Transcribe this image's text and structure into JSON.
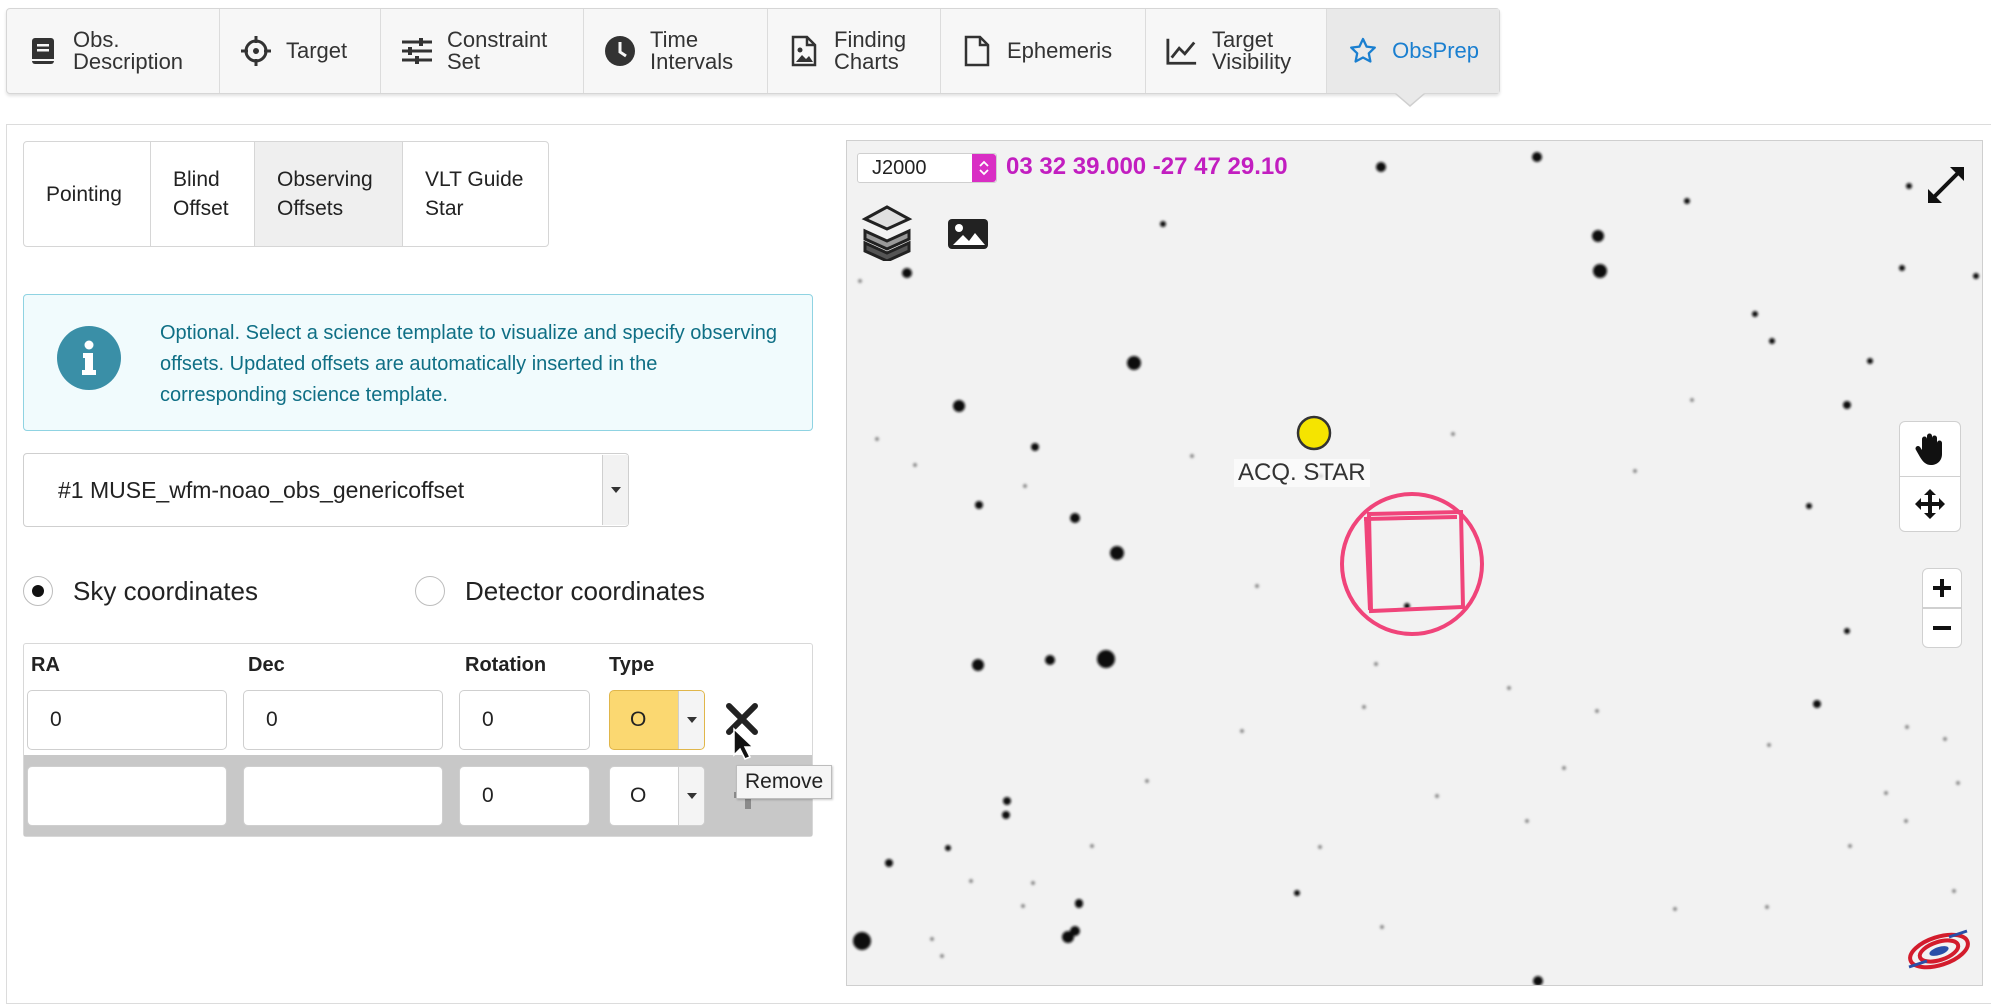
{
  "top_tabs": [
    {
      "label": "Obs.\nDescription",
      "icon": "book-icon"
    },
    {
      "label": "Target",
      "icon": "crosshair-icon"
    },
    {
      "label": "Constraint\nSet",
      "icon": "sliders-icon"
    },
    {
      "label": "Time\nIntervals",
      "icon": "clock-icon"
    },
    {
      "label": "Finding\nCharts",
      "icon": "image-file-icon"
    },
    {
      "label": "Ephemeris",
      "icon": "file-icon"
    },
    {
      "label": "Target\nVisibility",
      "icon": "line-chart-icon"
    },
    {
      "label": "ObsPrep",
      "icon": "star-icon",
      "active": true
    }
  ],
  "sub_tabs": [
    {
      "label": "Pointing"
    },
    {
      "label": "Blind\nOffset"
    },
    {
      "label": "Observing\nOffsets",
      "active": true
    },
    {
      "label": "VLT Guide\nStar"
    }
  ],
  "info": {
    "text": "Optional. Select a science template to visualize and specify observing offsets. Updated offsets are automatically inserted in the corresponding science template."
  },
  "template_select": {
    "value": "#1 MUSE_wfm-noao_obs_genericoffset"
  },
  "coord_mode": {
    "sky_label": "Sky coordinates",
    "detector_label": "Detector coordinates",
    "selected": "sky"
  },
  "offsets": {
    "headers": {
      "ra": "RA",
      "dec": "Dec",
      "rotation": "Rotation",
      "type": "Type"
    },
    "rows": [
      {
        "ra": "0",
        "dec": "0",
        "rotation": "0",
        "type": "O"
      },
      {
        "ra": "",
        "dec": "",
        "rotation": "0",
        "type": "O"
      }
    ],
    "remove_tooltip": "Remove"
  },
  "map": {
    "frame": "J2000",
    "coords": "03 32 39.000 -27 47 29.10",
    "acq_label": "ACQ. STAR",
    "accent_color": "#c21ec0",
    "fov_color": "#f0447a",
    "acq_color": "#f5e400"
  },
  "colors": {
    "active_tab": "#1a7fd0",
    "info_text": "#0f6f85",
    "info_icon_bg": "#3a8fa7",
    "type_highlight": "#fbd871"
  }
}
